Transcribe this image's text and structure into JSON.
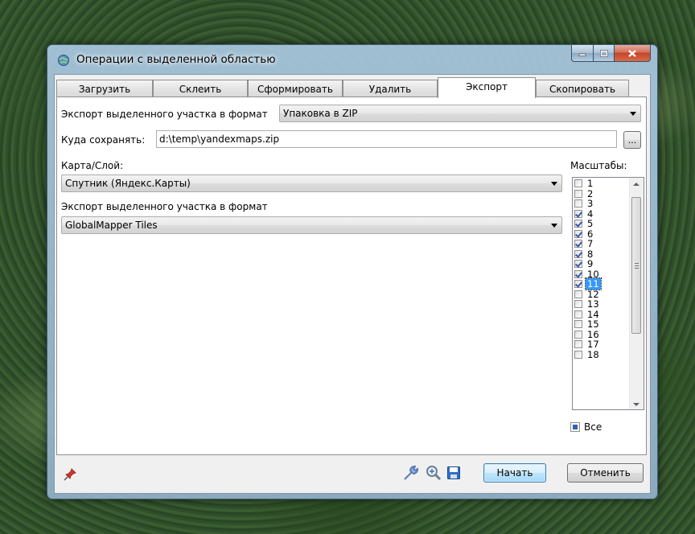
{
  "window": {
    "title": "Операции с выделенной областью"
  },
  "tabs": [
    {
      "label": "Загрузить"
    },
    {
      "label": "Склеить"
    },
    {
      "label": "Сформировать"
    },
    {
      "label": "Удалить"
    },
    {
      "label": "Экспорт"
    },
    {
      "label": "Скопировать"
    }
  ],
  "export": {
    "format_label": "Экспорт выделенного участка в формат",
    "format_value": "Упаковка в ZIP",
    "save_to_label": "Куда сохранять:",
    "save_to_value": "d:\\temp\\yandexmaps.zip",
    "browse_label": "...",
    "map_layer_label": "Карта/Слой:",
    "map_layer_value": "Спутник (Яндекс.Карты)",
    "tile_format_label": "Экспорт выделенного участка в формат",
    "tile_format_value": "GlobalMapper Tiles"
  },
  "scales": {
    "label": "Масштабы:",
    "items": [
      {
        "label": "1",
        "checked": false
      },
      {
        "label": "2",
        "checked": false
      },
      {
        "label": "3",
        "checked": false
      },
      {
        "label": "4",
        "checked": true
      },
      {
        "label": "5",
        "checked": true
      },
      {
        "label": "6",
        "checked": true
      },
      {
        "label": "7",
        "checked": true
      },
      {
        "label": "8",
        "checked": true
      },
      {
        "label": "9",
        "checked": true
      },
      {
        "label": "10",
        "checked": true
      },
      {
        "label": "11",
        "checked": true,
        "selected": true
      },
      {
        "label": "12",
        "checked": false
      },
      {
        "label": "13",
        "checked": false
      },
      {
        "label": "14",
        "checked": false
      },
      {
        "label": "15",
        "checked": false
      },
      {
        "label": "16",
        "checked": false
      },
      {
        "label": "17",
        "checked": false
      },
      {
        "label": "18",
        "checked": false
      }
    ],
    "all_label": "Все"
  },
  "footer": {
    "start_label": "Начать",
    "cancel_label": "Отменить"
  },
  "colors": {
    "accent": "#3399ff",
    "close": "#c4452b"
  }
}
